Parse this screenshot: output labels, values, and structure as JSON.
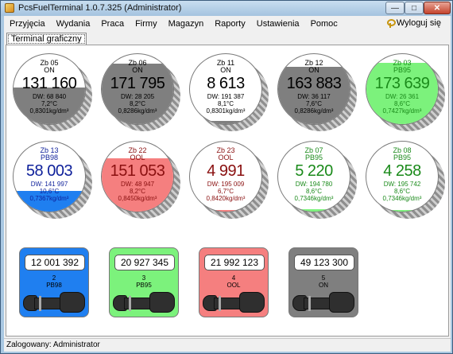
{
  "window": {
    "title": "PcsFuelTerminal 1.0.7.325 (Administrator)"
  },
  "menu": {
    "items": [
      "Przyjęcia",
      "Wydania",
      "Praca",
      "Firmy",
      "Magazyn",
      "Raporty",
      "Ustawienia",
      "Pomoc"
    ],
    "logout": "Wyloguj się"
  },
  "tabs": [
    {
      "label": "Terminal graficzny"
    }
  ],
  "tanks": [
    {
      "name": "Zb 05",
      "fuel": "ON",
      "volume": "131 160",
      "dw": "DW: 68 840",
      "temp": "7,2°C",
      "density": "0,8301kg/dm³",
      "fill": 0.52,
      "fill_color": "#7f7f7f",
      "text_color": "#000000"
    },
    {
      "name": "Zb 06",
      "fuel": "ON",
      "volume": "171 795",
      "dw": "DW: 28 205",
      "temp": "8,2°C",
      "density": "0,8286kg/dm³",
      "fill": 0.86,
      "fill_color": "#7f7f7f",
      "text_color": "#000000"
    },
    {
      "name": "Zb 11",
      "fuel": "ON",
      "volume": "8 613",
      "dw": "DW: 191 387",
      "temp": "8,1°C",
      "density": "0,8301kg/dm³",
      "fill": 0.04,
      "fill_color": "#7f7f7f",
      "text_color": "#000000"
    },
    {
      "name": "Zb 12",
      "fuel": "ON",
      "volume": "163 883",
      "dw": "DW: 36 117",
      "temp": "7,6°C",
      "density": "0,8286kg/dm³",
      "fill": 0.82,
      "fill_color": "#7f7f7f",
      "text_color": "#000000"
    },
    {
      "name": "Zb 03",
      "fuel": "PB95",
      "volume": "173 639",
      "dw": "DW: 26 361",
      "temp": "8,6°C",
      "density": "0,7427kg/dm³",
      "fill": 0.87,
      "fill_color": "#7cf27c",
      "text_color": "#1a8a1a"
    },
    {
      "name": "Zb 13",
      "fuel": "PB98",
      "volume": "58 003",
      "dw": "DW: 141 997",
      "temp": "10,6°C",
      "density": "0,7367kg/dm³",
      "fill": 0.29,
      "fill_color": "#1f7ff0",
      "text_color": "#0d1f9a"
    },
    {
      "name": "Zb 22",
      "fuel": "OOL",
      "volume": "151 053",
      "dw": "DW: 48 947",
      "temp": "8,2°C",
      "density": "0,8450kg/dm³",
      "fill": 0.76,
      "fill_color": "#f57f7f",
      "text_color": "#8a1010"
    },
    {
      "name": "Zb 23",
      "fuel": "OOL",
      "volume": "4 991",
      "dw": "DW: 195 009",
      "temp": "6,7°C",
      "density": "0,8420kg/dm³",
      "fill": 0.02,
      "fill_color": "#f57f7f",
      "text_color": "#8a1010"
    },
    {
      "name": "Zb 07",
      "fuel": "PB95",
      "volume": "5 220",
      "dw": "DW: 194 780",
      "temp": "8,6°C",
      "density": "0,7346kg/dm³",
      "fill": 0.03,
      "fill_color": "#7cf27c",
      "text_color": "#1a8a1a"
    },
    {
      "name": "Zb 08",
      "fuel": "PB95",
      "volume": "4 258",
      "dw": "DW: 195 742",
      "temp": "8,6°C",
      "density": "0,7346kg/dm³",
      "fill": 0.02,
      "fill_color": "#7cf27c",
      "text_color": "#1a8a1a"
    }
  ],
  "pumps": [
    {
      "counter": "12 001 392",
      "number": "2",
      "fuel": "PB98",
      "color": "#1f7ff0"
    },
    {
      "counter": "20 927 345",
      "number": "3",
      "fuel": "PB95",
      "color": "#7cf27c"
    },
    {
      "counter": "21 992 123",
      "number": "4",
      "fuel": "OOL",
      "color": "#f57f7f"
    },
    {
      "counter": "49 123 300",
      "number": "5",
      "fuel": "ON",
      "color": "#7f7f7f"
    }
  ],
  "status": {
    "text": "Zalogowany: Administrator"
  }
}
